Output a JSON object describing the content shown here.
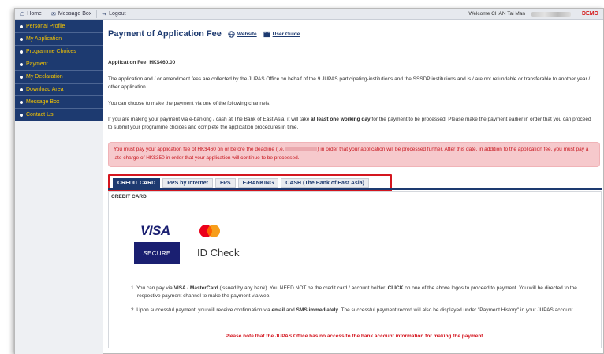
{
  "topbar": {
    "home": "Home",
    "message_box": "Message Box",
    "logout": "Logout",
    "welcome": "Welcome CHAN Tai Man",
    "demo": "DEMO"
  },
  "sidebar": {
    "items": [
      {
        "label": "Personal Profile"
      },
      {
        "label": "My Application"
      },
      {
        "label": "Programme Choices"
      },
      {
        "label": "Payment"
      },
      {
        "label": "My Declaration"
      },
      {
        "label": "Download Area"
      },
      {
        "label": "Message Box"
      },
      {
        "label": "Contact Us"
      }
    ]
  },
  "header": {
    "title": "Payment of Application Fee",
    "website": "Website",
    "user_guide": "User Guide"
  },
  "content": {
    "fee": "Application Fee: HK$460.00",
    "para1": "The application and / or amendment fees are collected by the JUPAS Office on behalf of the 9 JUPAS participating-institutions and the SSSDP institutions and is / are not refundable or transferable to another year / other application.",
    "para2": "You can choose to make the payment via one of the following channels.",
    "para3_a": "If you are making your payment via e-banking / cash at The Bank of East Asia, it will take ",
    "para3_b": "at least one working day",
    "para3_c": " for the payment to be processed. Please make the payment earlier in order that you can proceed to submit your programme choices and complete the application procedures in time.",
    "alert_a": "You must pay your application fee of HK$460 on or before the deadline (i.e. ",
    "alert_b": ") in order that your application will be processed further. After this date, in addition to the application fee, you must pay a late charge of HK$350 in order that your application will continue to be processed."
  },
  "tabs": [
    {
      "label": "CREDIT CARD",
      "active": true
    },
    {
      "label": "PPS by Internet",
      "active": false
    },
    {
      "label": "FPS",
      "active": false
    },
    {
      "label": "E-BANKING",
      "active": false
    },
    {
      "label": "CASH (The Bank of East Asia)",
      "active": false
    }
  ],
  "panel": {
    "label": "CREDIT CARD",
    "visa_logo": "VISA",
    "visa_secure": "SECURE",
    "mc_id_check": "ID Check",
    "item1_a": "1. You can pay via ",
    "item1_b": "VISA / MasterCard",
    "item1_c": " (issued by any bank). You NEED NOT be the credit card / account holder. ",
    "item1_d": "CLICK",
    "item1_e": " on one of the above logos to proceed to payment. You will be directed to the respective payment channel to make the payment via web.",
    "item2_a": "2. Upon successful payment, you will receive confirmation via ",
    "item2_b": "email",
    "item2_c": " and ",
    "item2_d": "SMS immediately",
    "item2_e": ". The successful payment record will also be displayed under \"Payment History\" in your JUPAS account.",
    "note": "Please note that the JUPAS Office has no access to the bank account information for making the payment."
  },
  "colors": {
    "nav_bg": "#1d3a70",
    "nav_text": "#f5c400",
    "alert_bg": "#f6c9cc",
    "alert_text": "#c7171f",
    "highlight_border": "#d4161f"
  }
}
